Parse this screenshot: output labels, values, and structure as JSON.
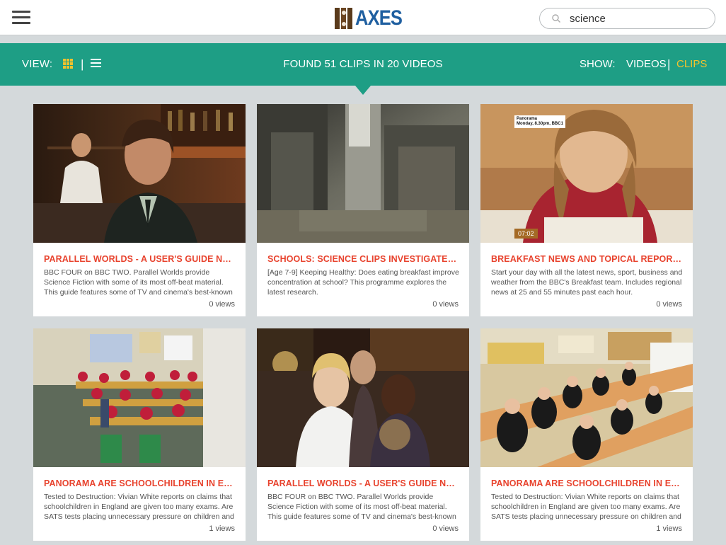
{
  "header": {
    "logo_text": "AXES",
    "search": {
      "value": "science",
      "placeholder": ""
    }
  },
  "toolbar": {
    "view_label": "VIEW:",
    "separator": "|",
    "found_text": "FOUND 51 CLIPS IN 20 VIDEOS",
    "show_label": "SHOW:",
    "videos_label": "VIDEOS",
    "clips_label": "CLIPS",
    "accent_color": "#1e9e85",
    "active_color": "#f2c22d"
  },
  "clips": [
    {
      "title": "PARALLEL WORLDS - A USER'S GUIDE NARRATED BY DAVID TENNANT",
      "description": "BBC FOUR on BBC TWO. Parallel Worlds provide Science Fiction with some of its most off-beat material. This guide features some of TV and cinema's best-known alternate",
      "views": "0 views"
    },
    {
      "title": "SCHOOLS: SCIENCE CLIPS INVESTIGATES DOES EATING BREAKFAST",
      "description": "[Age 7-9] Keeping Healthy: Does eating breakfast improve concentration at school? This programme explores the latest research.",
      "views": "0 views"
    },
    {
      "title": "BREAKFAST NEWS AND TOPICAL REPORTS.",
      "description": "Start your day with all the latest news, sport, business and weather from the BBC's Breakfast team. Includes regional news at 25 and 55 minutes past each hour.",
      "views": "0 views",
      "duration": "07:02",
      "overlay": [
        "Panorama",
        "Monday, 8.30pm, BBC1"
      ]
    },
    {
      "title": "PANORAMA ARE SCHOOLCHILDREN IN ENGLAND GIVEN TOO MANY EXAMS",
      "description": "Tested to Destruction: Vivian White reports on claims that schoolchildren in England are given too many exams. Are SATS tests placing unnecessary pressure on children and",
      "views": "1 views"
    },
    {
      "title": "PARALLEL WORLDS - A USER'S GUIDE NARRATED BY DAVID TENNANT",
      "description": "BBC FOUR on BBC TWO. Parallel Worlds provide Science Fiction with some of its most off-beat material. This guide features some of TV and cinema's best-known alternate",
      "views": "0 views"
    },
    {
      "title": "PANORAMA ARE SCHOOLCHILDREN IN ENGLAND GIVEN TOO MANY EXAMS",
      "description": "Tested to Destruction: Vivian White reports on claims that schoolchildren in England are given too many exams. Are SATS tests placing unnecessary pressure on children and",
      "views": "1 views"
    }
  ]
}
